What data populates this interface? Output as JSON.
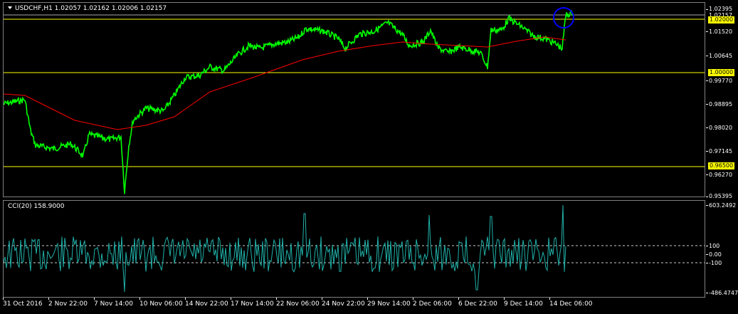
{
  "symbol_title": "USDCHF,H1  1.02057 1.02162 1.02006 1.02157",
  "cci_title": "CCI(20) 158.9000",
  "price_scale": [
    "1.02395",
    "1.02157",
    "1.01520",
    "1.00645",
    "0.99770",
    "0.98895",
    "0.98020",
    "0.97145",
    "0.96270",
    "0.95395"
  ],
  "price_levels": [
    "1.02000",
    "1.00000",
    "0.96500"
  ],
  "cci_scale": [
    "603.2492",
    "100",
    "0.00",
    "-100",
    "-486.4747"
  ],
  "time_labels": [
    "31 Oct 2016",
    "2 Nov 22:00",
    "7 Nov 14:00",
    "10 Nov 06:00",
    "14 Nov 22:00",
    "17 Nov 14:00",
    "22 Nov 06:00",
    "24 Nov 22:00",
    "29 Nov 14:00",
    "2 Dec 06:00",
    "6 Dec 22:00",
    "9 Dec 14:00",
    "14 Dec 06:00"
  ],
  "colors": {
    "background": "#000000",
    "price_line": "#00ff00",
    "moving_average": "#ff0000",
    "level_line": "#ffff00",
    "cci_line": "#20b2aa",
    "highlight_circle": "#0000ff"
  },
  "icons": {
    "menu": "dropdown-triangle-icon"
  }
}
